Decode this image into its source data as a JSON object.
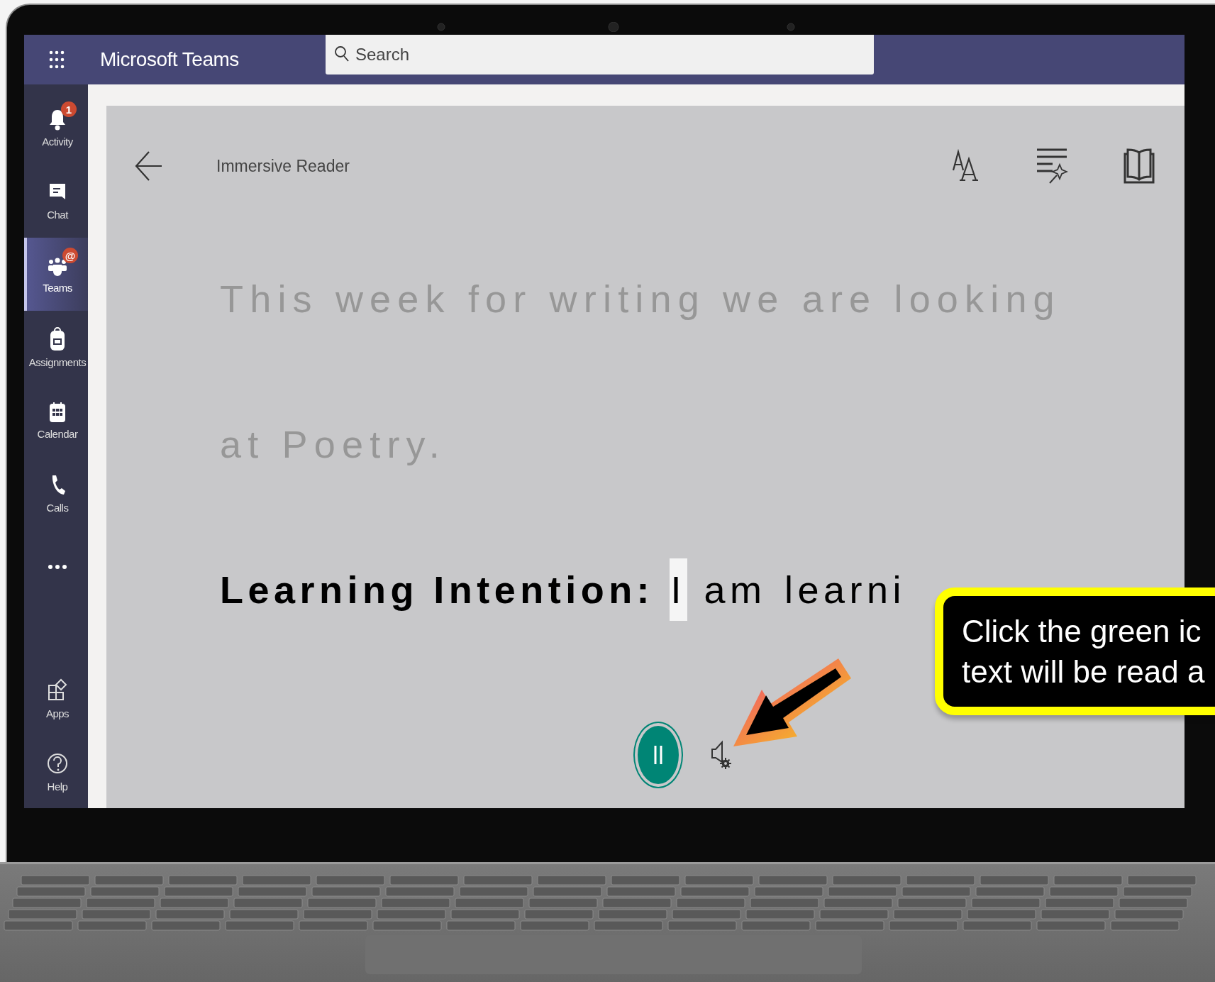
{
  "app": {
    "title": "Microsoft Teams"
  },
  "search": {
    "placeholder": "Search"
  },
  "sidebar": {
    "items": [
      {
        "label": "Activity",
        "kind": "bell",
        "badge": "1",
        "selected": false
      },
      {
        "label": "Chat",
        "kind": "chat",
        "selected": false
      },
      {
        "label": "Teams",
        "kind": "teams",
        "badge": "@",
        "selected": true
      },
      {
        "label": "Assignments",
        "kind": "bag",
        "selected": false
      },
      {
        "label": "Calendar",
        "kind": "calendar",
        "selected": false
      },
      {
        "label": "Calls",
        "kind": "phone",
        "selected": false
      },
      {
        "kind": "more",
        "selected": false
      }
    ],
    "bottom_items": [
      {
        "label": "Apps",
        "kind": "apps",
        "selected": false
      },
      {
        "label": "Help",
        "kind": "help",
        "selected": false
      }
    ]
  },
  "reader": {
    "title": "Immersive Reader",
    "lines": [
      {
        "kind": "dim",
        "text": "This week for writing we are looking"
      },
      {
        "kind": "dim",
        "text": "at Poetry."
      },
      {
        "kind": "current",
        "label": "Learning Intention:",
        "words": [
          {
            "text": "I",
            "selected": true
          },
          {
            "text": "am",
            "selected": false
          },
          {
            "text": "learni",
            "selected": false
          }
        ]
      }
    ],
    "player": {
      "playing": true
    }
  },
  "callout": {
    "lines": [
      "Click the green ic",
      "text will be read a"
    ]
  }
}
